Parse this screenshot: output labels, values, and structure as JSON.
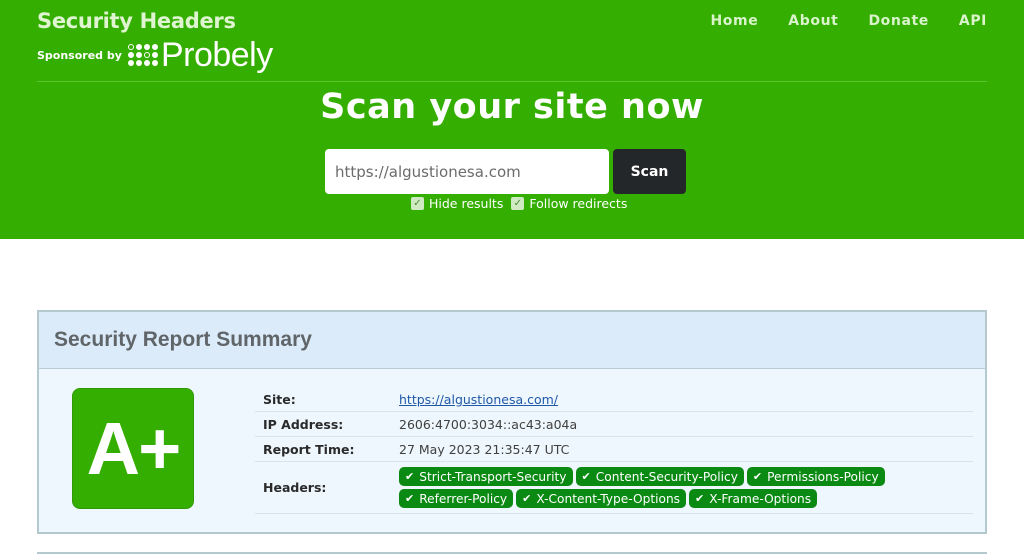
{
  "brand": {
    "title": "Security Headers",
    "sponsor_label": "Sponsored by",
    "sponsor_name": "Probely"
  },
  "nav": {
    "items": [
      {
        "label": "Home"
      },
      {
        "label": "About"
      },
      {
        "label": "Donate"
      },
      {
        "label": "API"
      }
    ]
  },
  "hero": {
    "headline": "Scan your site now",
    "input_value": "https://algustionesa.com",
    "scan_label": "Scan",
    "options": [
      {
        "label": "Hide results",
        "checked": true
      },
      {
        "label": "Follow redirects",
        "checked": true
      }
    ]
  },
  "report": {
    "title": "Security Report Summary",
    "grade": "A+",
    "grade_color": "#34ae00",
    "rows": {
      "site_label": "Site:",
      "site_value": "https://algustionesa.com/",
      "ip_label": "IP Address:",
      "ip_value": "2606:4700:3034::ac43:a04a",
      "time_label": "Report Time:",
      "time_value": "27 May 2023 21:35:47 UTC",
      "headers_label": "Headers:"
    },
    "headers": [
      {
        "label": "Strict-Transport-Security",
        "status": "present"
      },
      {
        "label": "Content-Security-Policy",
        "status": "present"
      },
      {
        "label": "Permissions-Policy",
        "status": "present"
      },
      {
        "label": "Referrer-Policy",
        "status": "present"
      },
      {
        "label": "X-Content-Type-Options",
        "status": "present"
      },
      {
        "label": "X-Frame-Options",
        "status": "present"
      }
    ],
    "header_pill_color": "#0b8a13",
    "check_glyph": "✔"
  }
}
